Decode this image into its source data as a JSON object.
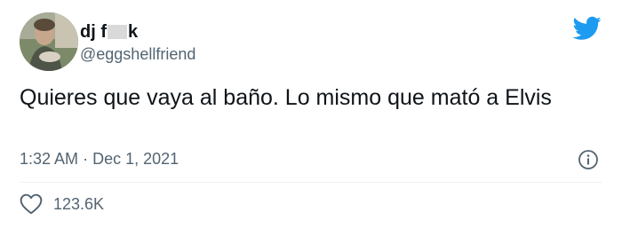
{
  "author": {
    "display_name_start": "dj f",
    "display_name_end": "k",
    "handle": "@eggshellfriend"
  },
  "tweet": {
    "text": "Quieres que vaya al baño. Lo mismo que mató a Elvis",
    "time": "1:32 AM",
    "separator": "·",
    "date": "Dec 1, 2021"
  },
  "engagement": {
    "likes": "123.6K"
  },
  "icons": {
    "brand": "twitter-bird-icon",
    "info": "info-icon",
    "like": "heart-icon"
  },
  "colors": {
    "brand": "#1d9bf0",
    "text": "#0f1419",
    "secondary": "#536471"
  }
}
